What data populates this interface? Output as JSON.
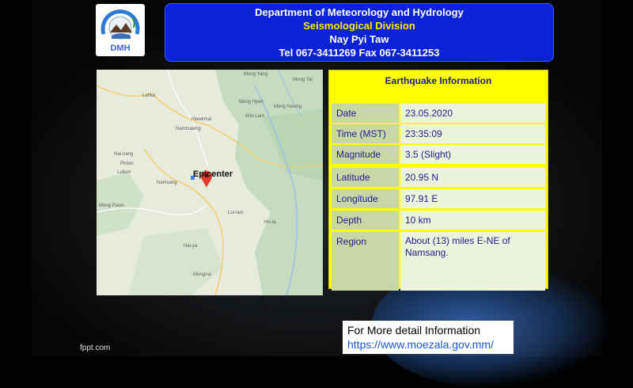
{
  "header": {
    "line1": "Department of Meteorology and Hydrology",
    "line2": "Seismological  Division",
    "line3": "Nay Pyi Taw",
    "line4": "Tel 067-3411269  Fax 067-3411253"
  },
  "logo": {
    "text": "DMH",
    "icon": "dmh-logo"
  },
  "map": {
    "epicenter_label": "Epicenter",
    "places": [
      "Mong Yang",
      "Lahka",
      "Mong Hpen",
      "Mawkmai",
      "Mong Nawng",
      "Namtsawng",
      "Mong Yai",
      "Kho Lam",
      "Hai-nang",
      "Pinion",
      "Loilem",
      "Namsang",
      "Mong Pawn",
      "Loi-lam",
      "Ho-ta",
      "Hai-ya",
      "Mongnai"
    ]
  },
  "info": {
    "title": "Earthquake  Information",
    "rows": [
      {
        "label": "Date",
        "value": "23.05.2020"
      },
      {
        "label": "Time (MST)",
        "value": "23:35:09"
      },
      {
        "label": "Magnitude",
        "value": "3.5 (Slight)"
      },
      {
        "label": "Latitude",
        "value": "20.95  N"
      },
      {
        "label": "Longitude",
        "value": "97.91  E"
      },
      {
        "label": "Depth",
        "value": " 10  km"
      },
      {
        "label": "Region",
        "value": "About  (13)  miles  E-NE  of  Namsang."
      }
    ]
  },
  "more": {
    "label": "For More detail Information",
    "link": "https://www.moezala.gov.mm/"
  },
  "footer": {
    "source": "fppt.com"
  }
}
